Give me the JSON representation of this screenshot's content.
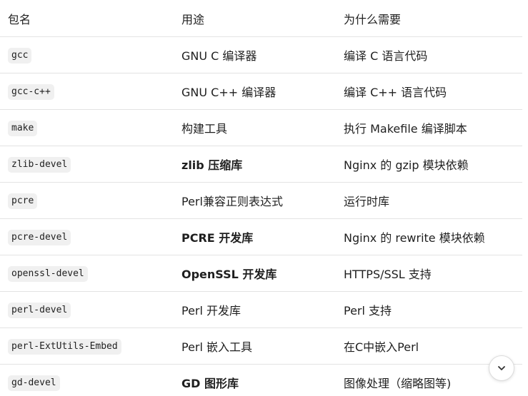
{
  "table": {
    "headers": [
      "包名",
      "用途",
      "为什么需要"
    ],
    "rows": [
      {
        "package": "gcc",
        "purpose": "GNU C 编译器",
        "purpose_bold": false,
        "reason": "编译 C 语言代码"
      },
      {
        "package": "gcc-c++",
        "purpose": "GNU C++ 编译器",
        "purpose_bold": false,
        "reason": "编译 C++ 语言代码"
      },
      {
        "package": "make",
        "purpose": "构建工具",
        "purpose_bold": false,
        "reason": "执行 Makefile 编译脚本"
      },
      {
        "package": "zlib-devel",
        "purpose": "zlib 压缩库",
        "purpose_bold": true,
        "reason": "Nginx 的 gzip 模块依赖"
      },
      {
        "package": "pcre",
        "purpose": "Perl兼容正则表达式",
        "purpose_bold": false,
        "reason": "运行时库"
      },
      {
        "package": "pcre-devel",
        "purpose": "PCRE 开发库",
        "purpose_bold": true,
        "reason": "Nginx 的 rewrite 模块依赖"
      },
      {
        "package": "openssl-devel",
        "purpose": "OpenSSL 开发库",
        "purpose_bold": true,
        "reason": "HTTPS/SSL 支持"
      },
      {
        "package": "perl-devel",
        "purpose": "Perl 开发库",
        "purpose_bold": false,
        "reason": "Perl 支持"
      },
      {
        "package": "perl-ExtUtils-Embed",
        "purpose": "Perl 嵌入工具",
        "purpose_bold": false,
        "reason": "在C中嵌入Perl"
      },
      {
        "package": "gd-devel",
        "purpose": "GD 图形库",
        "purpose_bold": true,
        "reason": "图像处理（缩略图等)"
      }
    ]
  },
  "scroll_button": {
    "icon": "chevron-down-icon"
  }
}
